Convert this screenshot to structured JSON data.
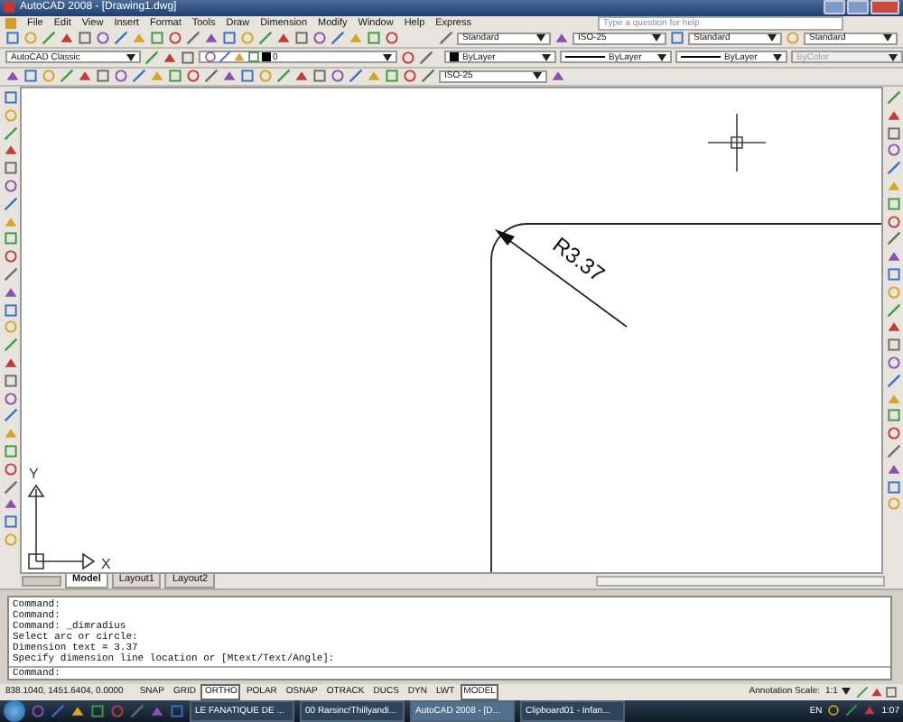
{
  "window": {
    "title": "AutoCAD 2008 - [Drawing1.dwg]",
    "help_placeholder": "Type a question for help"
  },
  "menu": [
    "File",
    "Edit",
    "View",
    "Insert",
    "Format",
    "Tools",
    "Draw",
    "Dimension",
    "Modify",
    "Window",
    "Help",
    "Express"
  ],
  "styles_toolbar": {
    "dropdowns": [
      "Standard",
      "ISO-25",
      "Standard",
      "Standard"
    ]
  },
  "workspace": {
    "value": "AutoCAD Classic"
  },
  "layers": {
    "value": "0"
  },
  "properties": [
    {
      "label": "ByLayer",
      "kind": "swatch",
      "disabled": false
    },
    {
      "label": "ByLayer",
      "kind": "line",
      "disabled": false
    },
    {
      "label": "ByLayer",
      "kind": "line",
      "disabled": false
    },
    {
      "label": "ByColor",
      "kind": "plain",
      "disabled": true
    }
  ],
  "dimension_toolbar": {
    "dimstyle": "ISO-25"
  },
  "drawing": {
    "dimension_text": "R3.37",
    "ucs_x": "X",
    "ucs_y": "Y"
  },
  "layout_tabs": [
    {
      "label": "Model",
      "selected": true
    },
    {
      "label": "Layout1",
      "selected": false
    },
    {
      "label": "Layout2",
      "selected": false
    }
  ],
  "command_history": [
    "Command:",
    "Command:",
    "Command:  _dimradius",
    "Select arc or circle:",
    "Dimension text = 3.37",
    "Specify dimension line location or [Mtext/Text/Angle]:"
  ],
  "command_prompt": "Command:",
  "status_bar": {
    "coordinates": "838.1040, 1451.6404, 0.0000",
    "toggles": [
      {
        "label": "SNAP",
        "on": false
      },
      {
        "label": "GRID",
        "on": false
      },
      {
        "label": "ORTHO",
        "on": true
      },
      {
        "label": "POLAR",
        "on": false
      },
      {
        "label": "OSNAP",
        "on": false
      },
      {
        "label": "OTRACK",
        "on": false
      },
      {
        "label": "DUCS",
        "on": false
      },
      {
        "label": "DYN",
        "on": false
      },
      {
        "label": "LWT",
        "on": false
      },
      {
        "label": "MODEL",
        "on": true
      }
    ],
    "annotation_scale_label": "Annotation Scale:",
    "annotation_scale": "1:1"
  },
  "taskbar": {
    "items": [
      {
        "label": "LE FANATIQUE DE ...",
        "selected": false
      },
      {
        "label": "00 Rarsinc!Thillyandi...",
        "selected": false
      },
      {
        "label": "AutoCAD 2008 - [D...",
        "selected": true
      },
      {
        "label": "Clipboard01 - Infan...",
        "selected": false
      }
    ],
    "language": "EN",
    "clock": "1:07"
  }
}
